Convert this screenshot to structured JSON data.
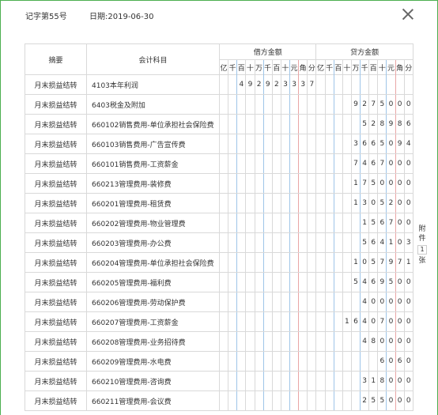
{
  "voucher": {
    "number_label": "记字第55号",
    "date_label": "日期:2019-06-30"
  },
  "table": {
    "col_summary": "摘要",
    "col_account": "会计科目",
    "col_debit": "借方金额",
    "col_credit": "贷方金额",
    "digit_units": [
      "亿",
      "千",
      "百",
      "十",
      "万",
      "千",
      "百",
      "十",
      "元",
      "角",
      "分"
    ],
    "rows": [
      {
        "summary": "月末损益结转",
        "account": "4103本年利润",
        "debit": "492923337",
        "credit": ""
      },
      {
        "summary": "月末损益结转",
        "account": "6403税金及附加",
        "debit": "",
        "credit": "9275000"
      },
      {
        "summary": "月末损益结转",
        "account": "660102销售费用-单位承担社会保险费",
        "debit": "",
        "credit": "528986"
      },
      {
        "summary": "月末损益结转",
        "account": "660103销售费用-广告宣传费",
        "debit": "",
        "credit": "3665094"
      },
      {
        "summary": "月末损益结转",
        "account": "660101销售费用-工资薪金",
        "debit": "",
        "credit": "7467000"
      },
      {
        "summary": "月末损益结转",
        "account": "660213管理费用-装修费",
        "debit": "",
        "credit": "1750000"
      },
      {
        "summary": "月末损益结转",
        "account": "660201管理费用-租赁费",
        "debit": "",
        "credit": "1305200"
      },
      {
        "summary": "月末损益结转",
        "account": "660202管理费用-物业管理费",
        "debit": "",
        "credit": "156700"
      },
      {
        "summary": "月末损益结转",
        "account": "660203管理费用-办公费",
        "debit": "",
        "credit": "564103"
      },
      {
        "summary": "月末损益结转",
        "account": "660204管理费用-单位承担社会保险费",
        "debit": "",
        "credit": "1057971"
      },
      {
        "summary": "月末损益结转",
        "account": "660205管理费用-福利费",
        "debit": "",
        "credit": "5469500"
      },
      {
        "summary": "月末损益结转",
        "account": "660206管理费用-劳动保护费",
        "debit": "",
        "credit": "400000"
      },
      {
        "summary": "月末损益结转",
        "account": "660207管理费用-工资薪金",
        "debit": "",
        "credit": "16407000"
      },
      {
        "summary": "月末损益结转",
        "account": "660208管理费用-业务招待费",
        "debit": "",
        "credit": "480000"
      },
      {
        "summary": "月末损益结转",
        "account": "660209管理费用-水电费",
        "debit": "",
        "credit": "6060"
      },
      {
        "summary": "月末损益结转",
        "account": "660210管理费用-咨询费",
        "debit": "",
        "credit": "318000"
      },
      {
        "summary": "月末损益结转",
        "account": "660211管理费用-会议费",
        "debit": "",
        "credit": "255000"
      }
    ]
  },
  "attachment": {
    "label_top": "附",
    "label_mid": "件",
    "count": "1",
    "label_bottom": "张"
  }
}
